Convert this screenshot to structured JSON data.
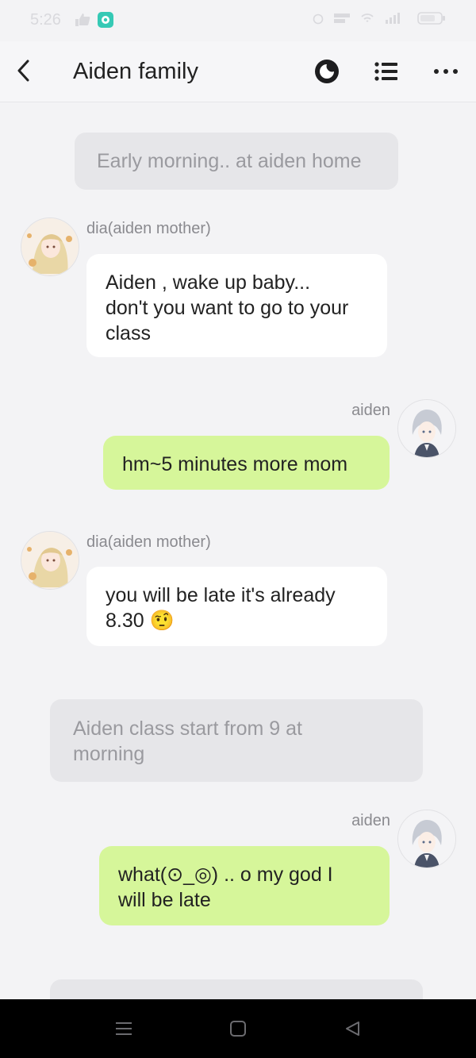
{
  "status_bar": {
    "time": "5:26"
  },
  "header": {
    "title": "Aiden family"
  },
  "messages": {
    "narration_1": "Early morning.. at aiden home",
    "m1_sender": "dia(aiden mother)",
    "m1_line1": "Aiden , wake up baby...",
    "m1_line2": "don't you want to go to your",
    "m1_line3": "class",
    "m2_sender": "aiden",
    "m2_text": "hm~5 minutes more mom",
    "m3_sender": "dia(aiden mother)",
    "m3_line1": "you will be late it's already",
    "m3_line2": "8.30 🤨",
    "narration_2_line1": "Aiden class start from 9 at",
    "narration_2_line2": "morning",
    "m4_sender": "aiden",
    "m4_line1": "what(⊙_◎) .. o my god I",
    "m4_line2": "will be late"
  },
  "colors": {
    "background": "#f3f3f5",
    "outgoing_bubble": "#d6f69a",
    "incoming_bubble": "#ffffff",
    "narration_bubble": "#e6e6e9",
    "nav_bar": "#000000"
  },
  "icons": {
    "back": "chevron-left-icon",
    "theme": "moon-icon",
    "list": "list-icon",
    "more": "more-dots-icon"
  }
}
